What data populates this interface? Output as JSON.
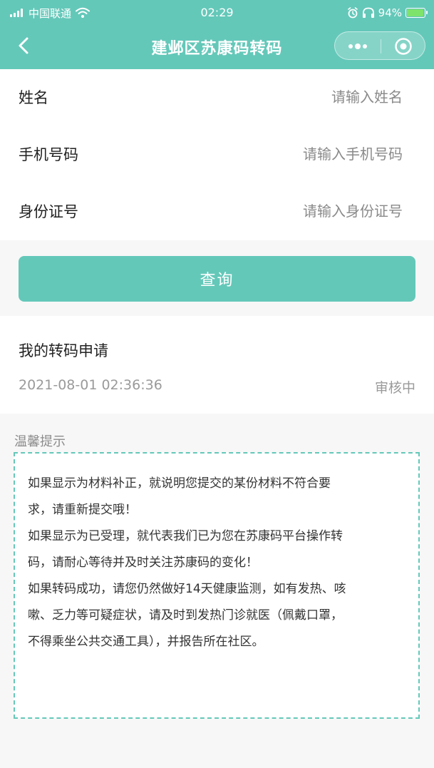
{
  "status_bar": {
    "carrier": "中国联通",
    "time": "02:29",
    "battery": "94%",
    "battery_level": 0.94
  },
  "nav": {
    "title": "建邺区苏康码转码"
  },
  "form": {
    "fields": [
      {
        "label": "姓名",
        "placeholder": "请输入姓名",
        "value": ""
      },
      {
        "label": "手机号码",
        "placeholder": "请输入手机号码",
        "value": ""
      },
      {
        "label": "身份证号",
        "placeholder": "请输入身份证号",
        "value": ""
      }
    ],
    "submit_label": "查询"
  },
  "applications": {
    "title": "我的转码申请",
    "items": [
      {
        "time": "2021-08-01 02:36:36",
        "status": "审核中"
      }
    ]
  },
  "tips": {
    "title": "温馨提示",
    "lines": [
      "如果显示为材料补正，就说明您提交的某份材料不符合要",
      "求，请重新提交哦！",
      "如果显示为已受理，就代表我们已为您在苏康码平台操作转",
      "码，请耐心等待并及时关注苏康码的变化！",
      "如果转码成功，请您仍然做好14天健康监测，如有发热、咳",
      "嗽、乏力等可疑症状，请及时到发热门诊就医（佩戴口罩，",
      "不得乘坐公共交通工具），并报告所在社区。"
    ]
  },
  "colors": {
    "accent": "#64c8b9",
    "background": "#f7f7f7"
  },
  "icons": [
    "signal-icon",
    "wifi-icon",
    "alarm-icon",
    "headphones-icon",
    "battery-icon",
    "back-icon",
    "more-icon",
    "close-icon"
  ]
}
